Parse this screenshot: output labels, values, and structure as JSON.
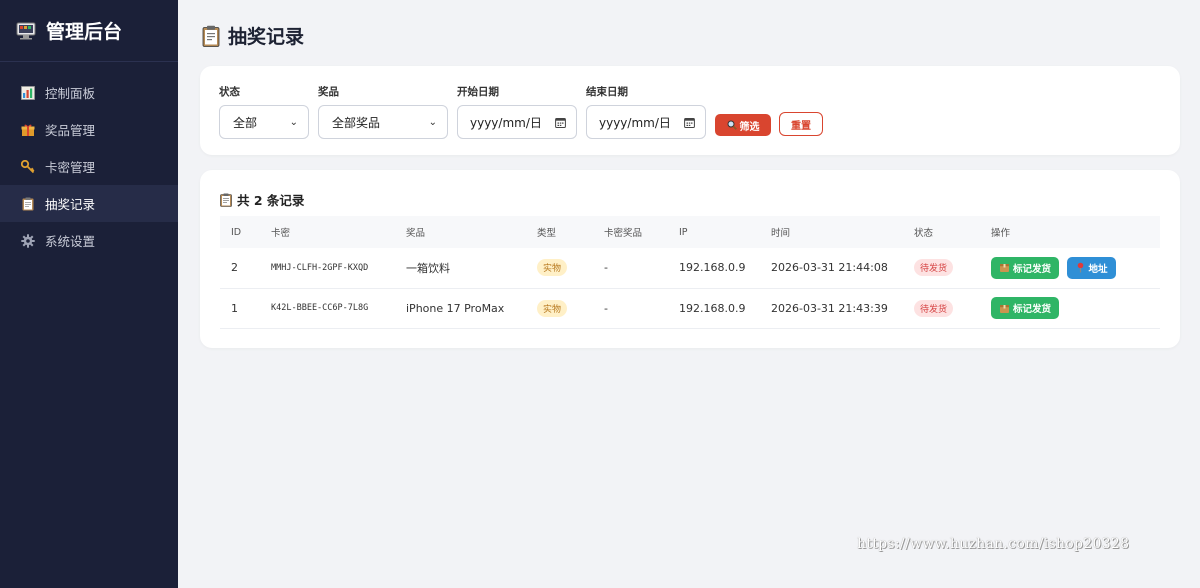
{
  "sidebar": {
    "brand_title": "管理后台",
    "items": [
      {
        "label": "控制面板",
        "icon": "bar-chart-icon",
        "active": false
      },
      {
        "label": "奖品管理",
        "icon": "gift-icon",
        "active": false
      },
      {
        "label": "卡密管理",
        "icon": "key-icon",
        "active": false
      },
      {
        "label": "抽奖记录",
        "icon": "clipboard-icon",
        "active": true
      },
      {
        "label": "系统设置",
        "icon": "gear-icon",
        "active": false
      }
    ]
  },
  "page": {
    "title": "抽奖记录"
  },
  "filters": {
    "status_label": "状态",
    "status_value": "全部",
    "prize_label": "奖品",
    "prize_value": "全部奖品",
    "start_label": "开始日期",
    "start_placeholder": "yyyy/mm/日",
    "end_label": "结束日期",
    "end_placeholder": "yyyy/mm/日",
    "filter_button": "筛选",
    "reset_button": "重置"
  },
  "records": {
    "count_text": "共 2 条记录",
    "columns": [
      "ID",
      "卡密",
      "奖品",
      "类型",
      "卡密奖品",
      "IP",
      "时间",
      "状态",
      "操作"
    ],
    "rows": [
      {
        "id": "2",
        "card": "MMHJ-CLFH-2GPF-KXQD",
        "prize": "一箱饮料",
        "type": "实物",
        "card_prize": "-",
        "ip": "192.168.0.9",
        "time": "2026-03-31 21:44:08",
        "status": "待发货",
        "action_ship": "标记发货",
        "action_addr": "地址"
      },
      {
        "id": "1",
        "card": "K42L-BBEE-CC6P-7L8G",
        "prize": "iPhone 17 ProMax",
        "type": "实物",
        "card_prize": "-",
        "ip": "192.168.0.9",
        "time": "2026-03-31 21:43:39",
        "status": "待发货",
        "action_ship": "标记发货"
      }
    ]
  },
  "colors": {
    "sidebar_bg": "#1b2038",
    "accent_red": "#d9452f",
    "ship_green": "#2fb566",
    "address_blue": "#2f8fd6"
  },
  "watermark": "https://www.huzhan.com/ishop20328"
}
